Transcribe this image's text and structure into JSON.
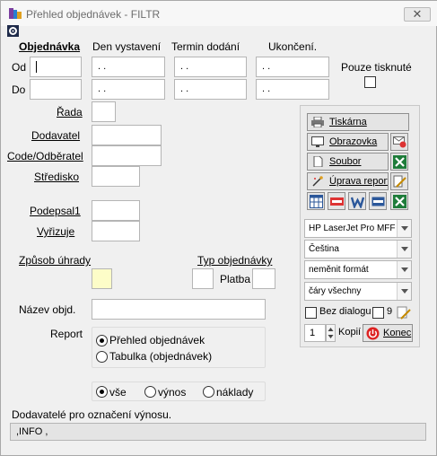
{
  "window": {
    "title": "Přehled objednávek - FILTR",
    "close_glyph": "✕"
  },
  "filters": {
    "col_order": "Objednávka",
    "col_issue": "Den vystavení",
    "col_delivery": "Termin dodání",
    "col_end": "Ukončení.",
    "row_from": "Od",
    "row_to": "Do",
    "date_placeholder": ". .",
    "print_only_label": "Pouze tisknuté"
  },
  "fields": {
    "rada": "Řada",
    "dodavatel": "Dodavatel",
    "code_odberatel": "Code/Odběratel",
    "stredisko": "Středisko",
    "podepsal": "Podepsal1",
    "vyrizuje": "Vyřizuje",
    "zpusob_uhrady": "Způsob úhrady",
    "typ_objednavky": "Typ objednávky",
    "platba": "Platba",
    "nazev_objd": "Název objd."
  },
  "report": {
    "label": "Report",
    "options": [
      "Přehled objednávek",
      "Tabulka (objednávek)"
    ],
    "selected": 0
  },
  "type_filter": {
    "options": [
      "vše",
      "výnos",
      "náklady"
    ],
    "selected": 0
  },
  "info_label": "Dodavatelé pro označení výnosu.",
  "info_value": ",INFO   ,",
  "panel": {
    "printer_btn": "Tiskárna",
    "screen_btn": "Obrazovka",
    "file_btn": "Soubor",
    "edit_btn": "Úprava report",
    "format_icons": [
      "grid-icon",
      "pdf-icon",
      "word-icon",
      "html-icon",
      "excel-icon"
    ],
    "printer_select": "HP LaserJet Pro MFF",
    "language_select": "Čeština",
    "format_select": "neměnit formát",
    "lines_select": "čáry všechny",
    "no_dialog_label": "Bez dialogu",
    "nine_label": "9",
    "copies_value": "1",
    "copies_label": "Kopií",
    "exit_btn": "Konec"
  },
  "colors": {
    "excel_green": "#1e7c3a",
    "word_blue": "#2b579a",
    "pdf_red": "#d33",
    "exit_red": "#d22",
    "yellow_field": "#fdfdc8"
  }
}
